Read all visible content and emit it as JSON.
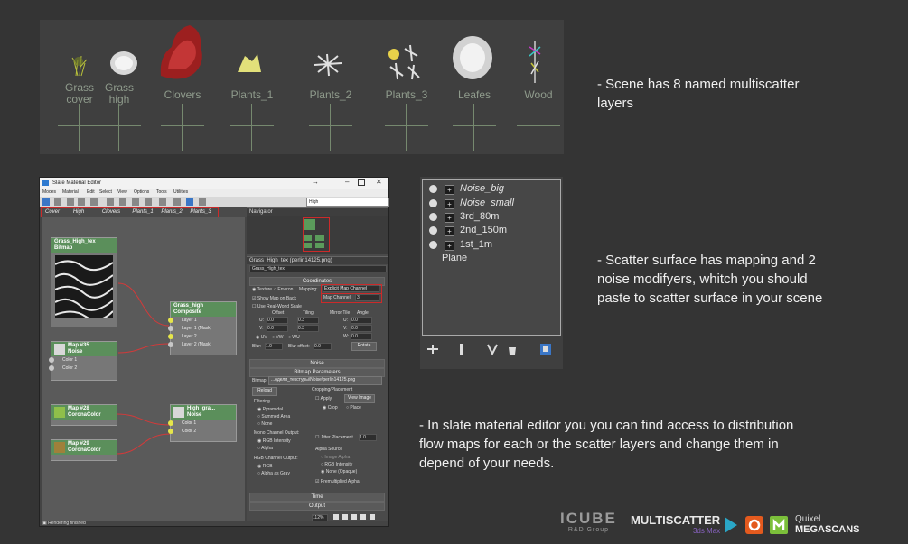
{
  "scene": {
    "layers": [
      {
        "name": "Grass\ncover",
        "color": "#b9c23a"
      },
      {
        "name": "Grass\nhigh",
        "color": "#e8e8e8"
      },
      {
        "name": "Clovers",
        "color": "#b82a2a"
      },
      {
        "name": "Plants_1",
        "color": "#e2e07a"
      },
      {
        "name": "Plants_2",
        "color": "#e8e8e8"
      },
      {
        "name": "Plants_3",
        "color": "#e8d24a"
      },
      {
        "name": "Leafes",
        "color": "#e8e8e8"
      },
      {
        "name": "Wood",
        "color": "#d6d6d6"
      }
    ]
  },
  "notes": {
    "n1_line1": "- Scene has 8 named multiscatter",
    "n1_line2": "layers",
    "n2_line1": "- Scatter surface has mapping and 2",
    "n2_line2": "noise modifyers, whitch you should",
    "n2_line3": "paste to scatter surface in your scene",
    "n3_line1": "- In slate material editor you you can find access to distribution",
    "n3_line2": "flow maps for each or the scatter layers and change them in",
    "n3_line3": "depend of your needs."
  },
  "sme": {
    "title": "Slate Material Editor",
    "menus": [
      "Modes",
      "Material",
      "Edit",
      "Select",
      "View",
      "Options",
      "Tools",
      "Utilities"
    ],
    "quality": "High",
    "tabs": [
      "Cover",
      "High",
      "Clovers",
      "Plants_1",
      "Plants_2",
      "Plants_3"
    ],
    "navigator": "Navigator",
    "map_title": "Grass_High_tex (perlin14125.png)",
    "map_name": "Grass_High_tex",
    "coordinates": "Coordinates",
    "texture": "Texture",
    "environ": "Environ",
    "mapping_label": "Mapping:",
    "mapping_value": "Explicit Map Channel",
    "show_map": "Show Map on Back",
    "real_world": "Use Real-World Scale",
    "map_channel_label": "Map Channel:",
    "map_channel_value": "3",
    "offset": "Offset",
    "tiling": "Tiling",
    "mirror_tile": "Mirror Tile",
    "angle": "Angle",
    "u_label": "U:",
    "v_label": "V:",
    "w_label": "W:",
    "u_offset": "0.0",
    "v_offset": "0.0",
    "u_tiling": "0.3",
    "v_tiling": "0.3",
    "u_angle": "0.0",
    "v_angle": "0.0",
    "w_angle": "0.0",
    "uv": "UV",
    "vw": "VW",
    "wu": "WU",
    "blur_label": "Blur:",
    "blur_value": "1.0",
    "blur_offset_label": "Blur offset:",
    "blur_offset_value": "0.0",
    "rotate": "Rotate",
    "noise_roll": "Noise",
    "bitmap_params": "Bitmap Parameters",
    "bitmap_label": "Bitmap:",
    "bitmap_path": "...одели_текстуры\\Noise\\perlin14125.png",
    "reload": "Reload",
    "cropping": "Cropping/Placement",
    "apply": "Apply",
    "view_image": "View Image",
    "crop": "Crop",
    "place": "Place",
    "filtering": "Filtering",
    "pyramidal": "Pyramidal",
    "summed_area": "Summed Area",
    "none": "None",
    "mono_output": "Mono Channel Output:",
    "rgb_intensity": "RGB Intensity",
    "alpha": "Alpha",
    "rgb_output": "RGB Channel Output:",
    "rgb": "RGB",
    "alpha_as_gray": "Alpha as Gray",
    "jitter": "Jitter Placement",
    "jitter_value": "1.0",
    "alpha_source": "Alpha Source",
    "image_alpha": "Image Alpha",
    "rgb_intensity2": "RGB Intensity",
    "none_opaque": "None (Opaque)",
    "premultiplied": "Premultiplied Alpha",
    "time_roll": "Time",
    "output_roll": "Output",
    "status": "Rendering finished",
    "zoom": "112%",
    "nodes": {
      "n1_title": "Grass_High_tex",
      "n1_sub": "Bitmap",
      "n2_title": "Grass_high",
      "n2_sub": "Composite",
      "n2_rows": [
        "Layer 1",
        "Layer 1 (Mask)",
        "Layer 2",
        "Layer 2 (Mask)"
      ],
      "n3_title": "Map #35",
      "n3_sub": "Noise",
      "n3_rows": [
        "Color 1",
        "Color 2"
      ],
      "n4_title": "Map #28",
      "n4_sub": "CoronaColor",
      "n5_title": "Map #29",
      "n5_sub": "CoronaColor",
      "n6_title": "High_gra...",
      "n6_sub": "Noise",
      "n6_rows": [
        "Color 1",
        "Color 2"
      ]
    }
  },
  "layers_panel": {
    "items": [
      "Noise_big",
      "Noise_small",
      "3rd_80m",
      "2nd_150m",
      "1st_1m",
      "Plane"
    ],
    "italic": [
      true,
      true,
      false,
      false,
      false,
      false
    ]
  },
  "logos": {
    "icube": "ICUBE",
    "icube_sub": "R&D Group",
    "multiscatter": "MULTISCATTER",
    "multiscatter_sub": "3ds Max",
    "quixel": "Quixel",
    "megascans": "MEGASCANS"
  },
  "colors": {
    "background": "#343434",
    "panel": "#3f3f3f",
    "highlight_red": "#cc2a2a",
    "node_green": "#5b8f5b"
  }
}
